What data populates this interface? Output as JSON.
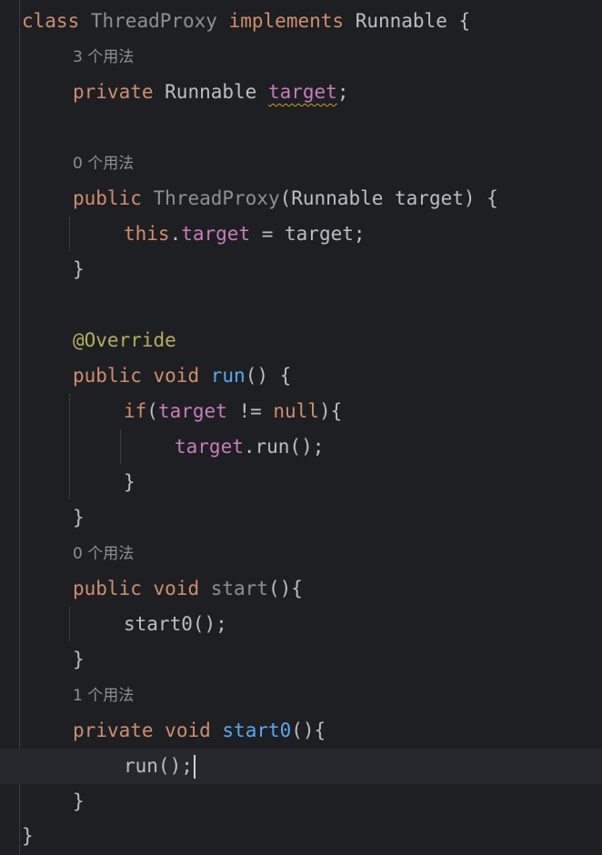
{
  "editor": {
    "lines": [
      {
        "tokens": [
          [
            "kw",
            "class"
          ],
          [
            "plain",
            " "
          ],
          [
            "cls-dim",
            "ThreadProxy"
          ],
          [
            "plain",
            " "
          ],
          [
            "kw",
            "implements"
          ],
          [
            "plain",
            " Runnable {"
          ]
        ]
      },
      {
        "hint": "3 个用法"
      },
      {
        "tokens": [
          [
            "kw",
            "private"
          ],
          [
            "plain",
            " Runnable "
          ],
          [
            "fld squiggle",
            "target"
          ],
          [
            "plain",
            ";"
          ]
        ]
      },
      {
        "tokens": []
      },
      {
        "hint": "0 个用法"
      },
      {
        "tokens": [
          [
            "kw",
            "public"
          ],
          [
            "plain",
            " "
          ],
          [
            "cls-dim",
            "ThreadProxy"
          ],
          [
            "plain",
            "(Runnable target) {"
          ]
        ]
      },
      {
        "tokens": [
          [
            "kw",
            "this"
          ],
          [
            "plain",
            "."
          ],
          [
            "fld",
            "target"
          ],
          [
            "plain",
            " = target;"
          ]
        ]
      },
      {
        "tokens": [
          [
            "plain",
            "}"
          ]
        ]
      },
      {
        "tokens": []
      },
      {
        "tokens": [
          [
            "ann",
            "@Override"
          ]
        ]
      },
      {
        "tokens": [
          [
            "kw",
            "public"
          ],
          [
            "plain",
            " "
          ],
          [
            "kw",
            "void"
          ],
          [
            "plain",
            " "
          ],
          [
            "fn",
            "run"
          ],
          [
            "plain",
            "() {"
          ]
        ]
      },
      {
        "tokens": [
          [
            "kw",
            "if"
          ],
          [
            "plain",
            "("
          ],
          [
            "fld",
            "target"
          ],
          [
            "plain",
            " != "
          ],
          [
            "kw",
            "null"
          ],
          [
            "plain",
            "){"
          ]
        ]
      },
      {
        "tokens": [
          [
            "fld",
            "target"
          ],
          [
            "plain",
            ".run();"
          ]
        ]
      },
      {
        "tokens": [
          [
            "plain",
            "}"
          ]
        ]
      },
      {
        "tokens": [
          [
            "plain",
            "}"
          ]
        ]
      },
      {
        "hint": "0 个用法"
      },
      {
        "tokens": [
          [
            "kw",
            "public"
          ],
          [
            "plain",
            " "
          ],
          [
            "kw",
            "void"
          ],
          [
            "plain",
            " "
          ],
          [
            "fn-dim",
            "start"
          ],
          [
            "plain",
            "(){"
          ]
        ]
      },
      {
        "tokens": [
          [
            "plain",
            "start0();"
          ]
        ]
      },
      {
        "tokens": [
          [
            "plain",
            "}"
          ]
        ]
      },
      {
        "hint": "1 个用法"
      },
      {
        "tokens": [
          [
            "kw",
            "private"
          ],
          [
            "plain",
            " "
          ],
          [
            "kw",
            "void"
          ],
          [
            "plain",
            " "
          ],
          [
            "fn",
            "start0"
          ],
          [
            "plain",
            "(){"
          ]
        ]
      },
      {
        "tokens": [
          [
            "plain",
            "run();"
          ]
        ],
        "caret": true
      },
      {
        "tokens": [
          [
            "plain",
            "}"
          ]
        ]
      },
      {
        "tokens": [
          [
            "plain",
            "}"
          ]
        ]
      }
    ]
  }
}
